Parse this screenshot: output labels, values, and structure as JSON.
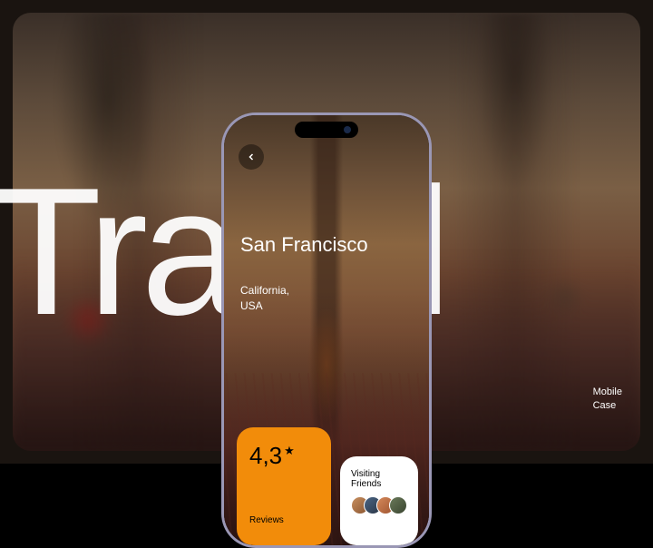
{
  "background": {
    "big_word": "Travel",
    "side_label_line1": "Mobile",
    "side_label_line2": "Case"
  },
  "phone": {
    "city": "San Francisco",
    "region_line1": "California,",
    "region_line2": "USA",
    "rating": {
      "value": "4,3",
      "star": "★",
      "label": "Reviews"
    },
    "friends": {
      "title": "Visiting Friends"
    }
  },
  "colors": {
    "accent_orange": "#f28c0a"
  }
}
